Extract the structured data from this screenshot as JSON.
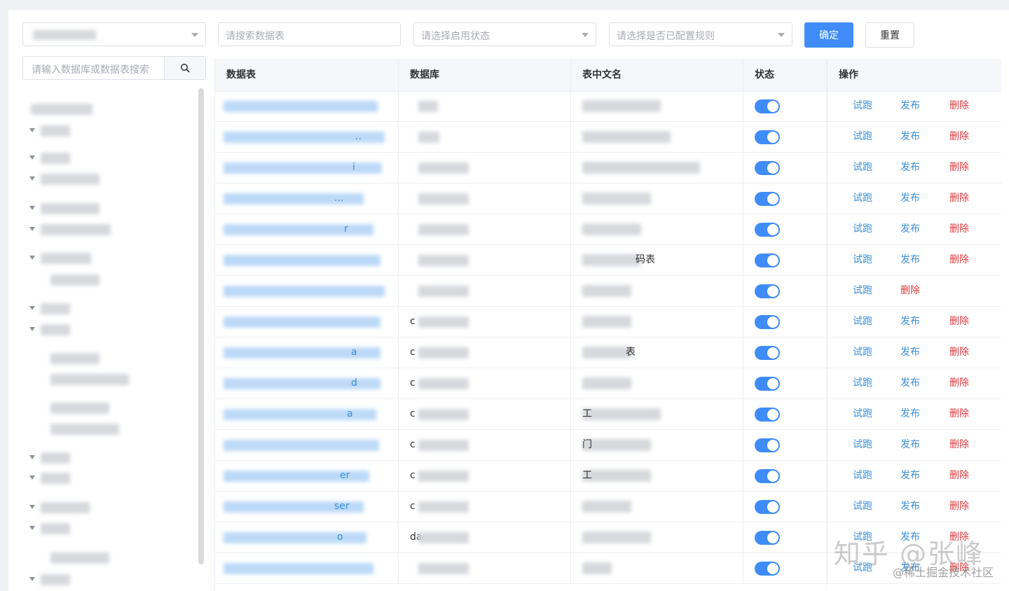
{
  "filters": {
    "search_table_placeholder": "请搜索数据表",
    "status_placeholder": "请选择启用状态",
    "rule_placeholder": "请选择是否已配置规则",
    "confirm_label": "确定",
    "reset_label": "重置"
  },
  "tree": {
    "search_placeholder": "请输入数据库或数据表搜索"
  },
  "table": {
    "columns": [
      "数据表",
      "数据库",
      "表中文名",
      "状态",
      "操作"
    ],
    "rows": [
      {
        "table_tail": "",
        "db_head": "",
        "cn_tail": "",
        "ops": [
          "试跑",
          "发布",
          "删除"
        ]
      },
      {
        "table_tail": "..",
        "db_head": "",
        "cn_tail": "",
        "ops": [
          "试跑",
          "发布",
          "删除"
        ]
      },
      {
        "table_tail": "i",
        "db_head": "",
        "cn_tail": "",
        "ops": [
          "试跑",
          "发布",
          "删除"
        ]
      },
      {
        "table_tail": "...",
        "db_head": "",
        "cn_tail": "",
        "ops": [
          "试跑",
          "发布",
          "删除"
        ]
      },
      {
        "table_tail": "r",
        "db_head": "",
        "cn_tail": "",
        "ops": [
          "试跑",
          "发布",
          "删除"
        ]
      },
      {
        "table_tail": "",
        "db_head": "",
        "cn_tail": "码表",
        "ops": [
          "试跑",
          "发布",
          "删除"
        ]
      },
      {
        "table_tail": "",
        "db_head": "",
        "cn_tail": "",
        "ops": [
          "试跑",
          "删除"
        ]
      },
      {
        "table_tail": "",
        "db_head": "c",
        "cn_tail": "",
        "ops": [
          "试跑",
          "发布",
          "删除"
        ]
      },
      {
        "table_tail": "a",
        "db_head": "c",
        "cn_tail": "表",
        "ops": [
          "试跑",
          "发布",
          "删除"
        ]
      },
      {
        "table_tail": "d",
        "db_head": "c",
        "cn_tail": "",
        "ops": [
          "试跑",
          "发布",
          "删除"
        ]
      },
      {
        "table_tail": "a",
        "db_head": "c",
        "cn_tail": "工",
        "ops": [
          "试跑",
          "发布",
          "删除"
        ]
      },
      {
        "table_tail": "",
        "db_head": "c",
        "cn_tail": "门",
        "ops": [
          "试跑",
          "发布",
          "删除"
        ]
      },
      {
        "table_tail": "er",
        "db_head": "c",
        "cn_tail": "工",
        "ops": [
          "试跑",
          "发布",
          "删除"
        ]
      },
      {
        "table_tail": "ser",
        "db_head": "c",
        "cn_tail": "",
        "ops": [
          "试跑",
          "发布",
          "删除"
        ]
      },
      {
        "table_tail": "o",
        "db_head": "da",
        "cn_tail": "",
        "ops": [
          "试跑",
          "发布",
          "删除"
        ]
      },
      {
        "table_tail": "",
        "db_head": "",
        "cn_tail": "",
        "ops": [
          "试跑",
          "发布",
          "删除"
        ]
      }
    ]
  },
  "watermark": {
    "main": "知乎 @张峰",
    "sub": "@稀土掘金技术社区"
  },
  "colors": {
    "primary": "#3f8cf8",
    "link": "#3b8fd9",
    "danger": "#e0393e"
  }
}
